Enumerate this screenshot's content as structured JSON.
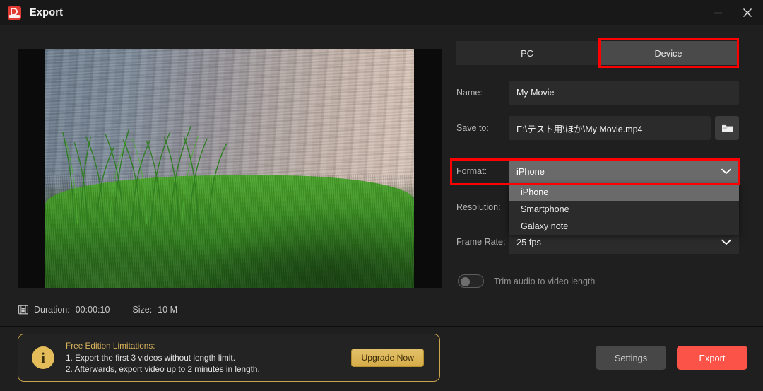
{
  "window": {
    "title": "Export",
    "logo_icon": "app-logo-icon",
    "minimize_label": "Minimize",
    "close_label": "Close"
  },
  "preview": {
    "description": "Video preview frame: lakeshore water with green grass and reeds in foreground",
    "letterbox": true
  },
  "meta": {
    "film_icon": "film-strip-icon",
    "duration_label": "Duration:",
    "duration_value": "00:00:10",
    "size_label": "Size:",
    "size_value": "10 M"
  },
  "notice": {
    "info_icon": "info-icon",
    "glyph": "i",
    "title": "Free Edition Limitations:",
    "line1": "1. Export the first 3 videos without length limit.",
    "line2": "2. Afterwards, export video up to 2 minutes in length.",
    "upgrade_label": "Upgrade Now",
    "border_color": "#c8a44a",
    "title_color": "#d8b35c",
    "button_color": "#d9b04e"
  },
  "tabs": [
    {
      "label": "PC",
      "active": false
    },
    {
      "label": "Device",
      "active": true
    }
  ],
  "fields": {
    "name": {
      "label": "Name:",
      "value": "My Movie"
    },
    "save_to": {
      "label": "Save to:",
      "value": "E:\\テスト用\\ほか\\My Movie.mp4",
      "browse_icon": "folder-icon"
    },
    "format": {
      "label": "Format:",
      "value": "iPhone",
      "chevron_icon": "chevron-down-icon",
      "open": true,
      "options": [
        {
          "label": "iPhone",
          "selected": true
        },
        {
          "label": "Smartphone",
          "selected": false
        },
        {
          "label": "Galaxy note",
          "selected": false
        }
      ]
    },
    "resolution": {
      "label": "Resolution:",
      "value": ""
    },
    "frame_rate": {
      "label": "Frame Rate:",
      "value": "25 fps",
      "chevron_icon": "chevron-down-icon"
    }
  },
  "trim_toggle": {
    "label": "Trim audio to video length",
    "state": "off"
  },
  "actions": {
    "settings_label": "Settings",
    "export_label": "Export",
    "export_color": "#fb5347"
  },
  "annotations": {
    "device_tab_highlight": "#fe0000",
    "format_row_highlight": "#fe0000"
  }
}
